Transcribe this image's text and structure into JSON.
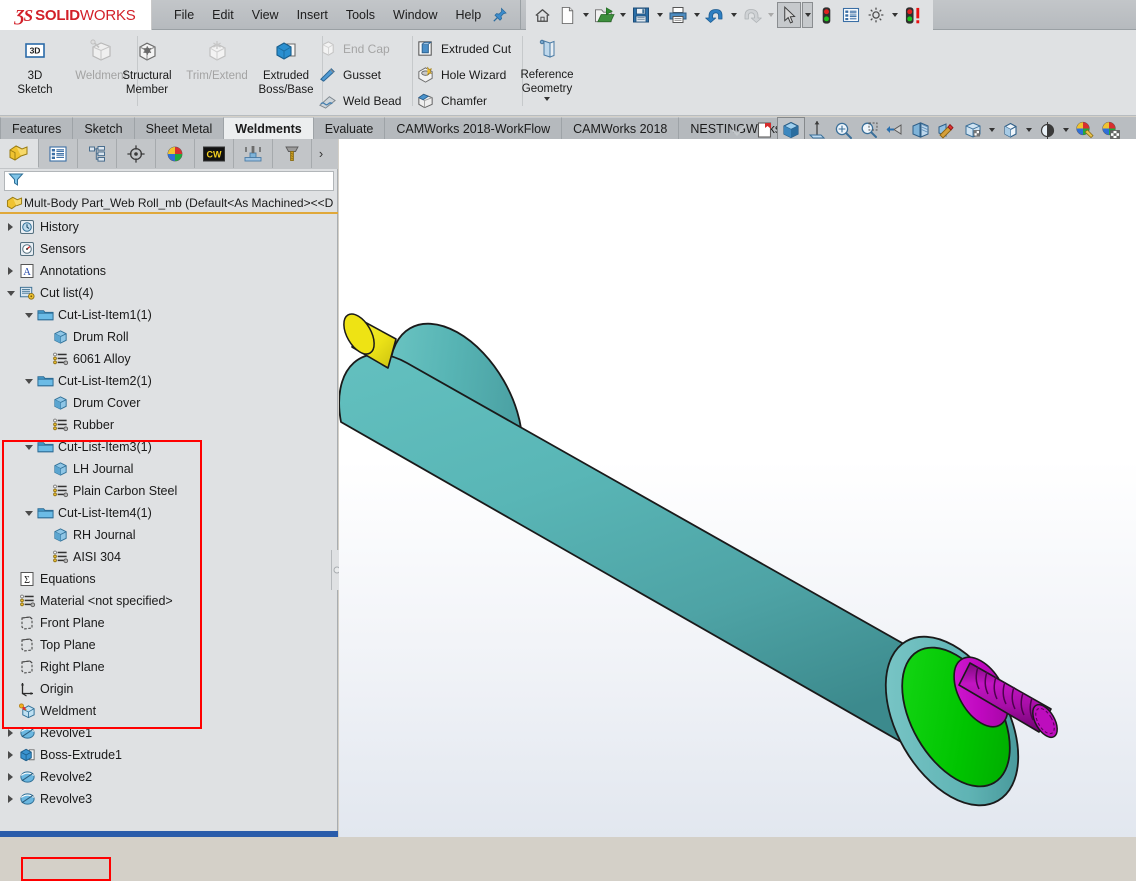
{
  "app": {
    "brand_ds": "ƷS",
    "brand_solid": "SOLID",
    "brand_works": "WORKS",
    "accent_red": "#d21f28",
    "accent_orange": "#e0a83a",
    "highlight_red": "#ff0000"
  },
  "menu": {
    "items": [
      {
        "label": "File"
      },
      {
        "label": "Edit"
      },
      {
        "label": "View"
      },
      {
        "label": "Insert"
      },
      {
        "label": "Tools"
      },
      {
        "label": "Window"
      },
      {
        "label": "Help"
      }
    ],
    "pin_icon": "pushpin-icon"
  },
  "quick_access": [
    {
      "name": "home-icon",
      "label": "Home",
      "dropdown": false
    },
    {
      "name": "new-document-icon",
      "label": "New",
      "dropdown": true
    },
    {
      "name": "open-folder-icon",
      "label": "Open",
      "dropdown": true
    },
    {
      "name": "save-icon",
      "label": "Save",
      "dropdown": true
    },
    {
      "name": "print-icon",
      "label": "Print",
      "dropdown": true
    },
    {
      "name": "undo-icon",
      "label": "Undo",
      "dropdown": true
    },
    {
      "name": "redo-icon",
      "label": "Redo",
      "dropdown": true
    },
    {
      "name": "select-cursor-icon",
      "label": "Select",
      "dropdown": true
    },
    {
      "name": "rebuild-traffic-light-icon",
      "label": "Rebuild",
      "dropdown": false
    },
    {
      "name": "file-properties-icon",
      "label": "File Properties",
      "dropdown": false
    },
    {
      "name": "options-gear-icon",
      "label": "Options",
      "dropdown": true
    },
    {
      "name": "rebuild-error-icon",
      "label": "Rebuild with errors",
      "dropdown": false
    }
  ],
  "ribbon": {
    "group1": [
      {
        "label_line1": "3D",
        "label_line2": "Sketch",
        "icon": "3d-sketch-icon",
        "disabled": false
      },
      {
        "label_line1": "Weldment",
        "label_line2": "",
        "icon": "weldment-icon",
        "disabled": true
      }
    ],
    "group2": [
      {
        "label_line1": "Structural",
        "label_line2": "Member",
        "icon": "structural-member-icon",
        "disabled": false
      },
      {
        "label_line1": "Trim/Extend",
        "label_line2": "",
        "icon": "trim-extend-icon",
        "disabled": true
      },
      {
        "label_line1": "Extruded",
        "label_line2": "Boss/Base",
        "icon": "extruded-boss-icon",
        "disabled": false
      }
    ],
    "group3": [
      {
        "label": "End Cap",
        "icon": "end-cap-icon",
        "disabled": true
      },
      {
        "label": "Gusset",
        "icon": "gusset-icon",
        "disabled": false
      },
      {
        "label": "Weld Bead",
        "icon": "weld-bead-icon",
        "disabled": false
      }
    ],
    "group4": [
      {
        "label": "Extruded Cut",
        "icon": "extruded-cut-icon",
        "disabled": false
      },
      {
        "label": "Hole Wizard",
        "icon": "hole-wizard-icon",
        "disabled": false
      },
      {
        "label": "Chamfer",
        "icon": "chamfer-icon",
        "disabled": false
      }
    ],
    "group5": [
      {
        "label_line1": "Reference",
        "label_line2": "Geometry",
        "icon": "reference-geometry-icon",
        "disabled": false
      }
    ]
  },
  "tabs": [
    {
      "label": "Features",
      "active": false
    },
    {
      "label": "Sketch",
      "active": false
    },
    {
      "label": "Sheet Metal",
      "active": false
    },
    {
      "label": "Weldments",
      "active": true
    },
    {
      "label": "Evaluate",
      "active": false
    },
    {
      "label": "CAMWorks 2018-WorkFlow",
      "active": false
    },
    {
      "label": "CAMWorks 2018",
      "active": false
    },
    {
      "label": "NESTINGWorks",
      "active": false
    }
  ],
  "view_toolbar": [
    {
      "name": "confirm-check-icon",
      "label": "Confirm",
      "disabled": true,
      "dropdown": false,
      "selected": false
    },
    {
      "name": "previous-view-icon",
      "label": "Previous View",
      "disabled": false,
      "dropdown": false,
      "selected": false
    },
    {
      "name": "view-orientation-icon",
      "label": "View Orientation",
      "disabled": false,
      "dropdown": false,
      "selected": true
    },
    {
      "name": "section-view-icon",
      "label": "Section View",
      "disabled": false,
      "dropdown": false,
      "selected": false
    },
    {
      "name": "zoom-to-fit-icon",
      "label": "Zoom to Fit",
      "disabled": false,
      "dropdown": false,
      "selected": false
    },
    {
      "name": "zoom-to-area-icon",
      "label": "Zoom to Area",
      "disabled": false,
      "dropdown": false,
      "selected": false
    },
    {
      "name": "rotate-view-icon",
      "label": "Rotate View",
      "disabled": false,
      "dropdown": false,
      "selected": false
    },
    {
      "name": "hide-show-items-icon",
      "label": "Hide/Show Items",
      "disabled": false,
      "dropdown": false,
      "selected": false
    },
    {
      "name": "edit-appearance-icon",
      "label": "Edit Appearance",
      "disabled": false,
      "dropdown": false,
      "selected": false
    },
    {
      "name": "apply-scene-icon",
      "label": "Apply Scene",
      "disabled": false,
      "dropdown": true,
      "selected": false
    },
    {
      "name": "display-style-icon",
      "label": "Display Style",
      "disabled": false,
      "dropdown": true,
      "selected": false
    },
    {
      "name": "view-settings-icon",
      "label": "View Settings",
      "disabled": false,
      "dropdown": true,
      "selected": false
    },
    {
      "name": "photoview-render-icon",
      "label": "PhotoView 360",
      "disabled": false,
      "dropdown": false,
      "selected": false
    },
    {
      "name": "final-render-icon",
      "label": "Final Render",
      "disabled": false,
      "dropdown": false,
      "selected": false
    }
  ],
  "panel_tabs": [
    {
      "name": "feature-manager-tab",
      "label": "FeatureManager design tree",
      "active": true
    },
    {
      "name": "property-manager-tab",
      "label": "PropertyManager",
      "active": false
    },
    {
      "name": "configuration-manager-tab",
      "label": "ConfigurationManager",
      "active": false
    },
    {
      "name": "dimxpert-manager-tab",
      "label": "DimXpertManager",
      "active": false
    },
    {
      "name": "display-manager-tab",
      "label": "DisplayManager",
      "active": false
    },
    {
      "name": "camworks-feature-tree-tab",
      "label": "CAMWorks Feature Tree",
      "active": false
    },
    {
      "name": "camworks-operation-tree-tab",
      "label": "CAMWorks Operation Tree",
      "active": false
    },
    {
      "name": "camworks-tools-tree-tab",
      "label": "CAMWorks Tools Tree",
      "active": false
    }
  ],
  "filter": {
    "icon": "filter-funnel-icon",
    "placeholder": "",
    "value": ""
  },
  "tree": {
    "root": "Mult-Body Part_Web Roll_mb  (Default<As Machined><<D",
    "root_icon": "part-document-icon",
    "nodes": [
      {
        "label": "History",
        "icon": "history-icon",
        "indent": 0,
        "arrow": "right",
        "highlight": false
      },
      {
        "label": "Sensors",
        "icon": "sensors-icon",
        "indent": 0,
        "arrow": "none",
        "highlight": false
      },
      {
        "label": "Annotations",
        "icon": "annotations-icon",
        "indent": 0,
        "arrow": "right",
        "highlight": false
      },
      {
        "label": "Cut list(4)",
        "icon": "cut-list-icon",
        "indent": 0,
        "arrow": "down",
        "highlight": true
      },
      {
        "label": "Cut-List-Item1(1)",
        "icon": "folder-icon",
        "indent": 1,
        "arrow": "down",
        "highlight": true
      },
      {
        "label": "Drum Roll",
        "icon": "solid-body-icon",
        "indent": 2,
        "arrow": "none",
        "highlight": true
      },
      {
        "label": "6061 Alloy",
        "icon": "material-icon",
        "indent": 2,
        "arrow": "none",
        "highlight": true
      },
      {
        "label": "Cut-List-Item2(1)",
        "icon": "folder-icon",
        "indent": 1,
        "arrow": "down",
        "highlight": true
      },
      {
        "label": "Drum Cover",
        "icon": "solid-body-icon",
        "indent": 2,
        "arrow": "none",
        "highlight": true
      },
      {
        "label": "Rubber",
        "icon": "material-icon",
        "indent": 2,
        "arrow": "none",
        "highlight": true
      },
      {
        "label": "Cut-List-Item3(1)",
        "icon": "folder-icon",
        "indent": 1,
        "arrow": "down",
        "highlight": true
      },
      {
        "label": "LH Journal",
        "icon": "solid-body-icon",
        "indent": 2,
        "arrow": "none",
        "highlight": true
      },
      {
        "label": "Plain Carbon Steel",
        "icon": "material-icon",
        "indent": 2,
        "arrow": "none",
        "highlight": true
      },
      {
        "label": "Cut-List-Item4(1)",
        "icon": "folder-icon",
        "indent": 1,
        "arrow": "down",
        "highlight": true
      },
      {
        "label": "RH Journal",
        "icon": "solid-body-icon",
        "indent": 2,
        "arrow": "none",
        "highlight": true
      },
      {
        "label": "AISI 304",
        "icon": "material-icon",
        "indent": 2,
        "arrow": "none",
        "highlight": true
      },
      {
        "label": "Equations",
        "icon": "equations-icon",
        "indent": 0,
        "arrow": "none",
        "highlight": false
      },
      {
        "label": "Material <not specified>",
        "icon": "material-icon",
        "indent": 0,
        "arrow": "none",
        "highlight": false
      },
      {
        "label": "Front Plane",
        "icon": "plane-icon",
        "indent": 0,
        "arrow": "none",
        "highlight": false
      },
      {
        "label": "Top Plane",
        "icon": "plane-icon",
        "indent": 0,
        "arrow": "none",
        "highlight": false
      },
      {
        "label": "Right Plane",
        "icon": "plane-icon",
        "indent": 0,
        "arrow": "none",
        "highlight": false
      },
      {
        "label": "Origin",
        "icon": "origin-icon",
        "indent": 0,
        "arrow": "none",
        "highlight": false
      },
      {
        "label": "Weldment",
        "icon": "weldment-feature-icon",
        "indent": 0,
        "arrow": "none",
        "highlight": true
      },
      {
        "label": "Revolve1",
        "icon": "revolve-icon",
        "indent": 0,
        "arrow": "right",
        "highlight": false
      },
      {
        "label": "Boss-Extrude1",
        "icon": "boss-extrude-icon",
        "indent": 0,
        "arrow": "right",
        "highlight": false
      },
      {
        "label": "Revolve2",
        "icon": "revolve-icon",
        "indent": 0,
        "arrow": "right",
        "highlight": false
      },
      {
        "label": "Revolve3",
        "icon": "revolve-icon",
        "indent": 0,
        "arrow": "right",
        "highlight": false
      }
    ]
  },
  "model": {
    "name": "web-roll-drum-model",
    "bodies": [
      {
        "name": "Drum Cover",
        "color": "#5BB8B8",
        "description": "main teal rubber-covered drum cylinder"
      },
      {
        "name": "Drum Roll",
        "color": "#00C000",
        "description": "green end face of drum roll"
      },
      {
        "name": "LH Journal",
        "color": "#EDE312",
        "description": "yellow left-hand journal shaft stub"
      },
      {
        "name": "RH Journal",
        "color": "#C009C0",
        "description": "magenta right-hand threaded journal shaft"
      }
    ],
    "background": "white to light blue-grey gradient"
  }
}
